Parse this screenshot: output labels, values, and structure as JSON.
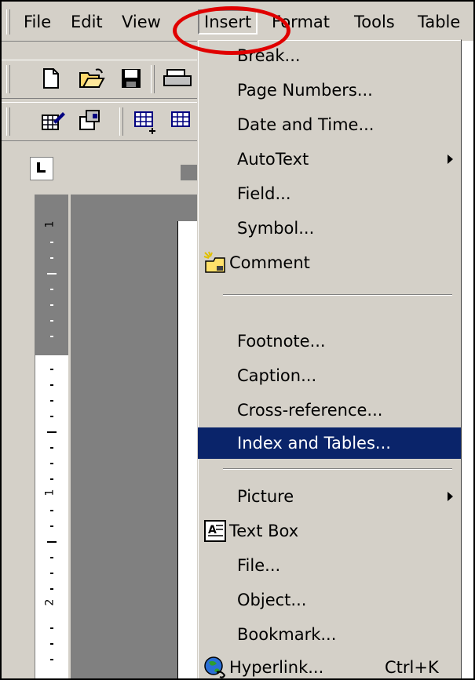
{
  "menubar": {
    "items": [
      {
        "label": "File"
      },
      {
        "label": "Edit"
      },
      {
        "label": "View"
      },
      {
        "label": "Insert"
      },
      {
        "label": "Format"
      },
      {
        "label": "Tools"
      },
      {
        "label": "Table"
      }
    ]
  },
  "ruler": {
    "vertical_numbers": [
      "1",
      "1",
      "2"
    ]
  },
  "insert_menu": {
    "items": [
      {
        "label": "Break..."
      },
      {
        "label": "Page Numbers..."
      },
      {
        "label": "Date and Time..."
      },
      {
        "label": "AutoText",
        "submenu": true
      },
      {
        "label": "Field..."
      },
      {
        "label": "Symbol..."
      },
      {
        "label": "Comment",
        "icon": "comment-icon"
      },
      {
        "label": "Footnote..."
      },
      {
        "label": "Caption..."
      },
      {
        "label": "Cross-reference..."
      },
      {
        "label": "Index and Tables...",
        "highlighted": true
      },
      {
        "label": "Picture",
        "submenu": true
      },
      {
        "label": "Text Box",
        "icon": "text-box-icon"
      },
      {
        "label": "File..."
      },
      {
        "label": "Object..."
      },
      {
        "label": "Bookmark..."
      },
      {
        "label": "Hyperlink...",
        "shortcut": "Ctrl+K",
        "icon": "hyperlink-globe-icon"
      }
    ]
  },
  "colors": {
    "menu_background": "#d4d0c8",
    "highlight": "#0a246a",
    "highlight_text": "#ffffff",
    "annotation_ring": "#e00000"
  }
}
